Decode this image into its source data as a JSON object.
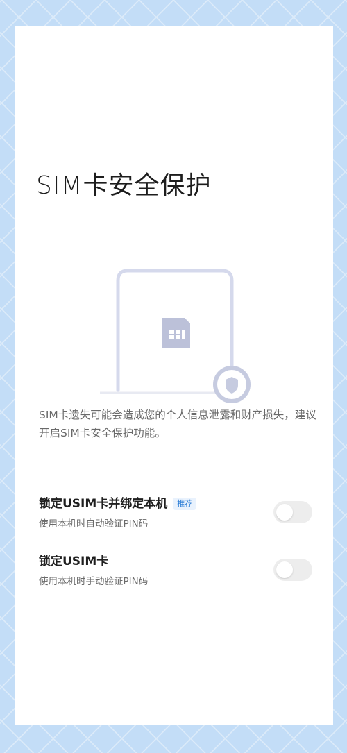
{
  "page": {
    "title": "SIM卡安全保护",
    "description": "SIM卡遗失可能会造成您的个人信息泄露和财产损失，建议开启SIM卡安全保护功能。"
  },
  "illustration": {
    "icons": [
      "sim-card-icon",
      "shield-icon"
    ],
    "colors": {
      "frame": "#d5d9ec",
      "sim": "#bcc1d9",
      "shield": "#c6cbe0"
    }
  },
  "settings": [
    {
      "title": "锁定USIM卡并绑定本机",
      "badge": "推荐",
      "subtitle": "使用本机时自动验证PIN码",
      "enabled": false
    },
    {
      "title": "锁定USIM卡",
      "subtitle": "使用本机时手动验证PIN码",
      "enabled": false
    }
  ],
  "colors": {
    "background": "#c3ddf7",
    "badge_text": "#2f7fd6",
    "toggle_off": "#ededed"
  }
}
